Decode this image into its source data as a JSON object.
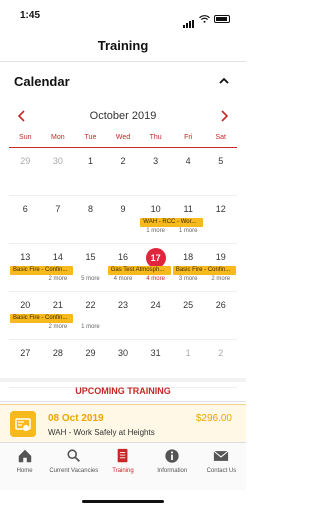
{
  "status": {
    "time": "1:45"
  },
  "header": {
    "title": "Training"
  },
  "calendar": {
    "title": "Calendar",
    "month_label": "October 2019",
    "weekdays": [
      "Sun",
      "Mon",
      "Tue",
      "Wed",
      "Thu",
      "Fri",
      "Sat"
    ],
    "weeks": [
      {
        "days": [
          {
            "n": "29",
            "m": true
          },
          {
            "n": "30",
            "m": true
          },
          {
            "n": "1"
          },
          {
            "n": "2"
          },
          {
            "n": "3"
          },
          {
            "n": "4"
          },
          {
            "n": "5"
          }
        ]
      },
      {
        "days": [
          {
            "n": "6"
          },
          {
            "n": "7"
          },
          {
            "n": "8"
          },
          {
            "n": "9"
          },
          {
            "n": "10",
            "more": "1 more"
          },
          {
            "n": "11",
            "more": "1 more"
          },
          {
            "n": "12"
          }
        ],
        "events": [
          {
            "text": "WAH - RCC - Wor...",
            "start": 4,
            "span": 2
          }
        ]
      },
      {
        "days": [
          {
            "n": "13"
          },
          {
            "n": "14",
            "more": "2 more"
          },
          {
            "n": "15",
            "more": "5 more"
          },
          {
            "n": "16",
            "more": "4 more"
          },
          {
            "n": "17",
            "today": true,
            "more": "4 more",
            "red": true
          },
          {
            "n": "18",
            "more": "3 more"
          },
          {
            "n": "19",
            "more": "2 more"
          }
        ],
        "events": [
          {
            "text": "Basic Fire - Confin...",
            "start": 0,
            "span": 2
          },
          {
            "text": "Gas Test Atmosph...",
            "start": 3,
            "span": 2
          },
          {
            "text": "Basic Fire - Confin...",
            "start": 5,
            "span": 2
          }
        ]
      },
      {
        "days": [
          {
            "n": "20"
          },
          {
            "n": "21",
            "more": "2 more"
          },
          {
            "n": "22",
            "more": "1 more"
          },
          {
            "n": "23"
          },
          {
            "n": "24"
          },
          {
            "n": "25"
          },
          {
            "n": "26"
          }
        ],
        "events": [
          {
            "text": "Basic Fire - Confin...",
            "start": 0,
            "span": 2
          }
        ]
      },
      {
        "days": [
          {
            "n": "27"
          },
          {
            "n": "28"
          },
          {
            "n": "29"
          },
          {
            "n": "30"
          },
          {
            "n": "31"
          },
          {
            "n": "1",
            "m": true
          },
          {
            "n": "2",
            "m": true
          }
        ]
      }
    ]
  },
  "upcoming": {
    "title": "UPCOMING TRAINING",
    "item": {
      "date": "08 Oct 2019",
      "price": "$296.00",
      "name": "WAH - Work Safely at Heights"
    }
  },
  "tabs": [
    {
      "label": "Home",
      "icon": "home-icon"
    },
    {
      "label": "Current Vacancies",
      "icon": "search-icon"
    },
    {
      "label": "Training",
      "icon": "training-icon",
      "active": true
    },
    {
      "label": "Information",
      "icon": "info-icon"
    },
    {
      "label": "Contact Us",
      "icon": "mail-icon"
    }
  ],
  "colors": {
    "accent": "#c62828",
    "event": "#f7b91b",
    "today": "#e0263c"
  }
}
